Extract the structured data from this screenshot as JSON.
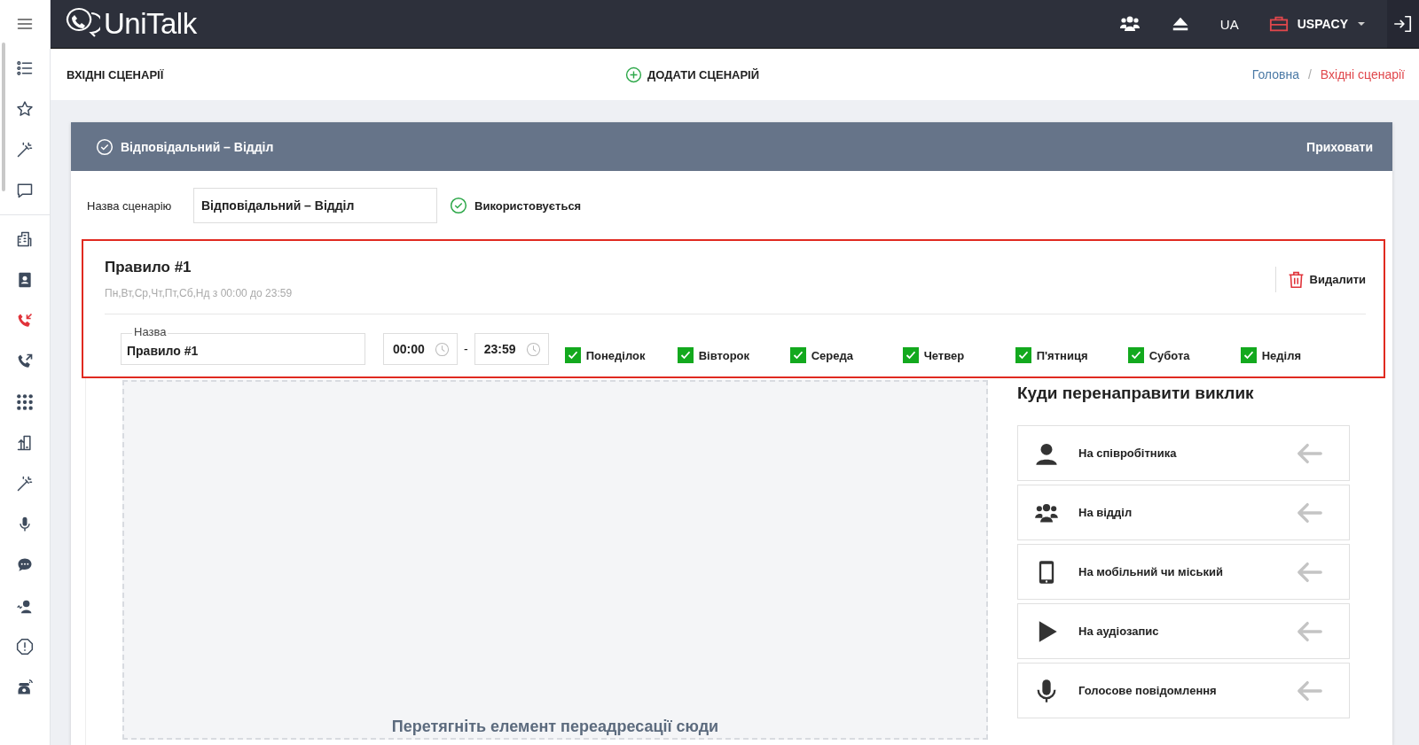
{
  "topbar": {
    "logo": "UniTalk",
    "language": "UA",
    "company": "USPACY"
  },
  "sidebar": {
    "items": [
      {
        "selected": false
      },
      {
        "selected": false
      },
      {
        "selected": false
      },
      {
        "selected": false
      },
      {
        "selected": false
      },
      {
        "selected": false
      },
      {
        "selected": true
      },
      {
        "selected": false
      },
      {
        "selected": false
      },
      {
        "selected": false
      },
      {
        "selected": false
      },
      {
        "selected": false
      },
      {
        "selected": false
      },
      {
        "selected": false
      },
      {
        "selected": false
      },
      {
        "selected": false
      }
    ]
  },
  "page_header": {
    "title": "ВХІДНІ СЦЕНАРІЇ",
    "add_button": "ДОДАТИ СЦЕНАРІЙ",
    "breadcrumb_separator": "/",
    "breadcrumbs": [
      {
        "label": "Головна",
        "selected": false
      },
      {
        "label": "Вхідні сценарії",
        "selected": true
      }
    ]
  },
  "scenario": {
    "title": "Відповідальний – Відділ",
    "hide_button": "Приховати",
    "name_label": "Назва сценарію",
    "name_value": "Відповідальний – Відділ",
    "status": "Використовується",
    "active": true
  },
  "rule": {
    "highlighted": true,
    "title": "Правило #1",
    "summary": "Пн,Вт,Ср,Чт,Пт,Сб,Нд з 00:00 до 23:59",
    "delete_button": "Видалити",
    "name_label": "Назва",
    "name_value": "Правило #1",
    "time_from": "00:00",
    "time_separator": "-",
    "time_to": "23:59",
    "days": [
      {
        "label": "Понеділок",
        "checked": true
      },
      {
        "label": "Вівторок",
        "checked": true
      },
      {
        "label": "Середа",
        "checked": true
      },
      {
        "label": "Четвер",
        "checked": true
      },
      {
        "label": "П'ятниця",
        "checked": true
      },
      {
        "label": "Субота",
        "checked": true
      },
      {
        "label": "Неділя",
        "checked": true
      }
    ]
  },
  "drop_zone": {
    "hint": "Перетягніть елемент переадресації сюди"
  },
  "redirect": {
    "title": "Куди перенаправити виклик",
    "options": [
      {
        "label": "На співробітника"
      },
      {
        "label": "На відділ"
      },
      {
        "label": "На мобільний чи міський"
      },
      {
        "label": "На аудіозапис"
      },
      {
        "label": "Голосове повідомлення"
      }
    ]
  }
}
